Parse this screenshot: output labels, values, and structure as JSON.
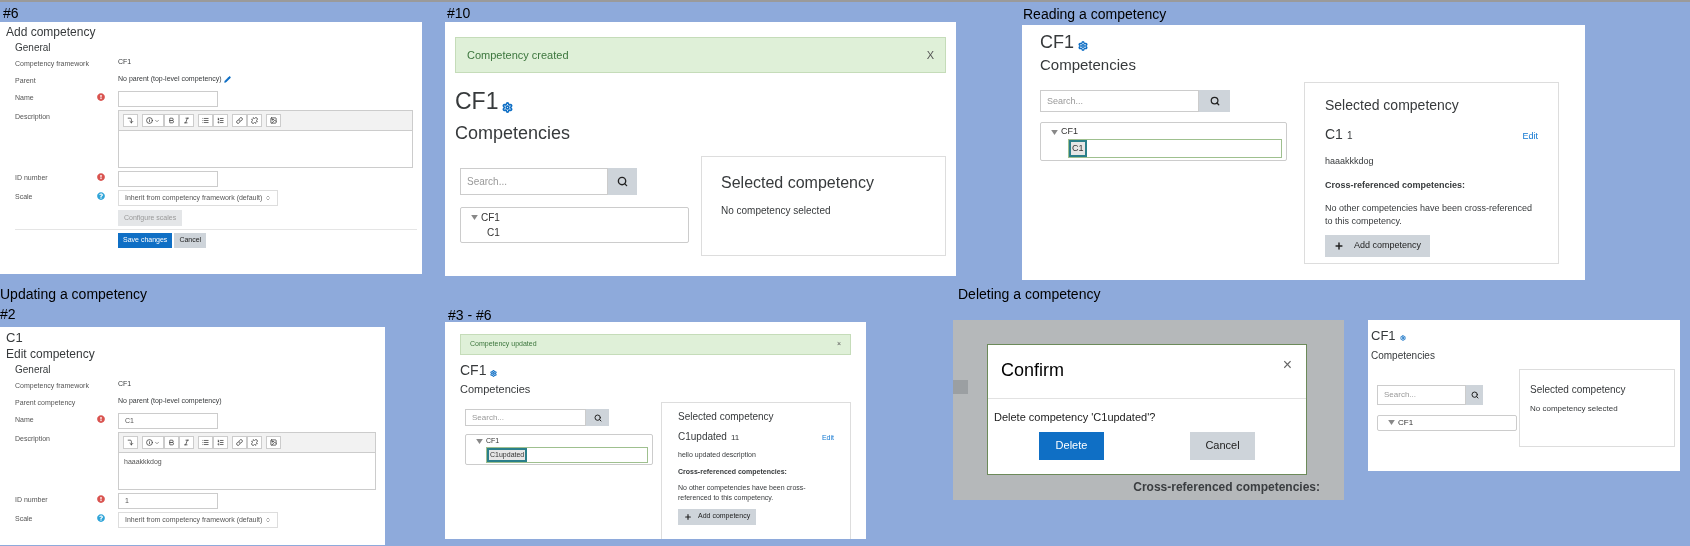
{
  "panels": [
    {
      "kind": "form",
      "captions": [
        "#6"
      ],
      "heading": "Add competency",
      "legend": "General",
      "fields": [
        {
          "kind": "static",
          "label": "Competency framework",
          "value": "CF1",
          "editable": false,
          "required": false,
          "help": false
        },
        {
          "kind": "static",
          "label": "Parent",
          "value": "No parent (top-level competency)",
          "editable": true,
          "required": false,
          "help": false
        },
        {
          "kind": "text",
          "label": "Name",
          "required": true,
          "help": false
        },
        {
          "kind": "editor",
          "label": "Description",
          "required": false,
          "help": false
        },
        {
          "kind": "text",
          "label": "ID number",
          "required": true,
          "help": false
        },
        {
          "kind": "select",
          "label": "Scale",
          "value": "Inherit from competency framework (default)",
          "required": false,
          "help": true,
          "extra_button": {
            "label": "Configure scales",
            "disabled": true
          }
        }
      ],
      "buttons": [
        {
          "label": "Save changes",
          "primary": true
        },
        {
          "label": "Cancel",
          "primary": false
        }
      ]
    },
    {
      "kind": "framework",
      "captions": [
        "#10"
      ],
      "alert": {
        "text": "Competency created",
        "dismiss": "X"
      },
      "framework": "CF1",
      "heading": "Competencies",
      "search_placeholder": "Search...",
      "tree": [
        {
          "label": "CF1",
          "expanded": true,
          "children": [
            {
              "label": "C1",
              "selected": false
            }
          ]
        }
      ],
      "detail": {
        "title": "Selected competency",
        "empty_text": "No competency selected"
      }
    },
    {
      "kind": "framework",
      "captions": [
        "Reading a competency"
      ],
      "framework": "CF1",
      "heading": "Competencies",
      "search_placeholder": "Search...",
      "tree": [
        {
          "label": "CF1",
          "expanded": true,
          "children": [
            {
              "label": "C1",
              "selected": true
            }
          ]
        }
      ],
      "detail": {
        "title": "Selected competency",
        "name": "C1",
        "idnumber": "1",
        "edit": "Edit",
        "description": "haaakkkdog",
        "crossref_heading": "Cross-referenced competencies:",
        "crossref_text": "No other competencies have been cross-referenced to this competency.",
        "add_button": "Add competency"
      }
    },
    {
      "kind": "form",
      "captions": [
        "Updating a competency",
        "#2"
      ],
      "title": "C1",
      "heading": "Edit competency",
      "legend": "General",
      "fields": [
        {
          "kind": "static",
          "label": "Competency framework",
          "value": "CF1",
          "editable": false,
          "required": false,
          "help": false
        },
        {
          "kind": "static",
          "label": "Parent competency",
          "value": "No parent (top-level competency)",
          "editable": false,
          "required": false,
          "help": false
        },
        {
          "kind": "text",
          "label": "Name",
          "value": "C1",
          "required": true,
          "help": false
        },
        {
          "kind": "editor",
          "label": "Description",
          "value": "haaakkkdog",
          "required": false,
          "help": false
        },
        {
          "kind": "text",
          "label": "ID number",
          "value": "1",
          "required": true,
          "help": false
        },
        {
          "kind": "select",
          "label": "Scale",
          "value": "Inherit from competency framework (default)",
          "required": false,
          "help": true
        }
      ]
    },
    {
      "kind": "framework",
      "captions": [
        "#3 - #6"
      ],
      "alert": {
        "text": "Competency updated",
        "dismiss": "×"
      },
      "framework": "CF1",
      "heading": "Competencies",
      "search_placeholder": "Search...",
      "tree": [
        {
          "label": "CF1",
          "expanded": true,
          "children": [
            {
              "label": "C1updated",
              "selected": true
            }
          ]
        }
      ],
      "detail": {
        "title": "Selected competency",
        "name": "C1updated",
        "idnumber": "11",
        "edit": "Edit",
        "description": "hello updated description",
        "crossref_heading": "Cross-referenced competencies:",
        "crossref_text": "No other competencies have been cross-referenced to this competency.",
        "add_button": "Add competency"
      }
    },
    {
      "kind": "confirm",
      "captions": [
        "Deleting a competency"
      ],
      "dialog": {
        "title": "Confirm",
        "close": "×",
        "message": "Delete competency 'C1updated'?",
        "buttons": [
          {
            "label": "Delete",
            "primary": true
          },
          {
            "label": "Cancel",
            "primary": false
          }
        ]
      },
      "background_text": "Cross-referenced competencies:"
    },
    {
      "kind": "framework",
      "framework": "CF1",
      "heading": "Competencies",
      "search_placeholder": "Search...",
      "tree": [
        {
          "label": "CF1",
          "expanded": true
        }
      ],
      "detail": {
        "title": "Selected competency",
        "empty_text": "No competency selected"
      }
    }
  ]
}
